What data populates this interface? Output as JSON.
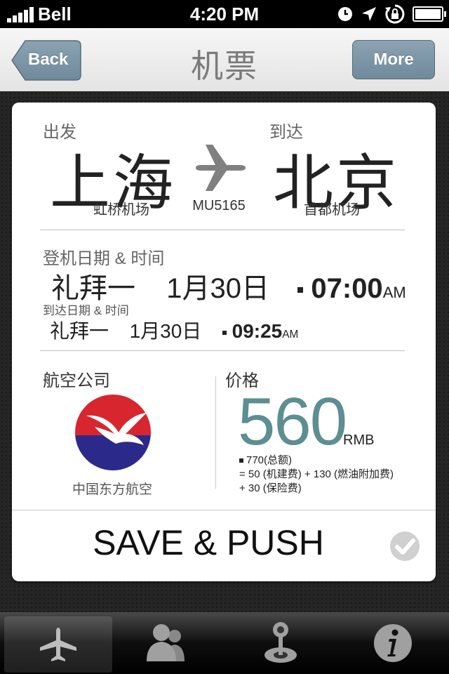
{
  "status_bar": {
    "carrier": "Bell",
    "time": "4:20 PM",
    "icons": [
      "alarm-icon",
      "location-arrow-icon",
      "rotation-lock-icon",
      "battery-icon"
    ]
  },
  "nav": {
    "back_label": "Back",
    "title": "机票",
    "more_label": "More"
  },
  "ticket": {
    "depart_label": "出发",
    "depart_city": "上海",
    "depart_airport": "虹桥机场",
    "arrive_label": "到达",
    "arrive_city": "北京",
    "arrive_airport": "首都机场",
    "flight_no": "MU5165",
    "boarding_label": "登机日期 & 时间",
    "boarding_day": "礼拜一",
    "boarding_date": "1月30日",
    "boarding_time": "07:00",
    "boarding_ampm": "AM",
    "arrival_label": "到达日期 & 时间",
    "arrival_day": "礼拜一",
    "arrival_date": "1月30日",
    "arrival_time": "09:25",
    "arrival_ampm": "AM",
    "airline_label": "航空公司",
    "airline_name": "中国东方航空",
    "price_label": "价格",
    "price": "560",
    "currency": "RMB",
    "breakdown_1": "770(总额)",
    "breakdown_2": "= 50 (机建费) + 130 (燃油附加费)",
    "breakdown_3": "+ 30 (保险费)",
    "save_label": "SAVE & PUSH"
  },
  "tabbar": {
    "tabs": [
      "plane-icon",
      "contacts-icon",
      "joystick-icon",
      "info-icon"
    ],
    "active_index": 0
  },
  "colors": {
    "price": "#5c8e92",
    "nav_button": "#7b95a6",
    "logo_red": "#d7262e",
    "logo_blue": "#2b2a8a"
  }
}
